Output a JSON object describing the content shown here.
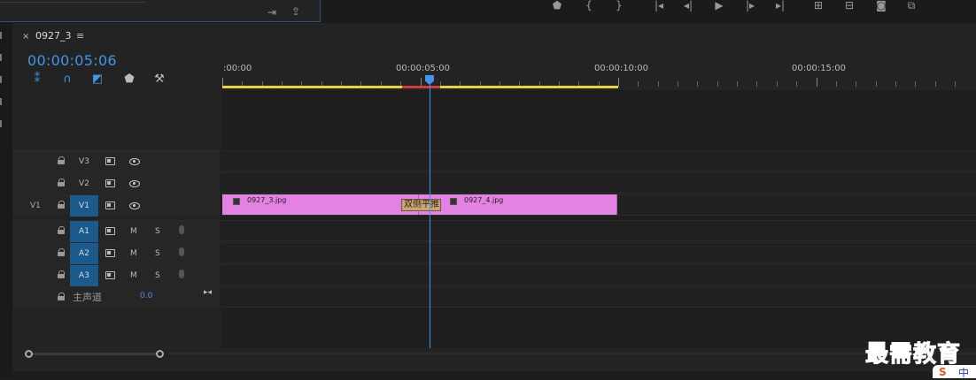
{
  "sequence": {
    "tab_close": "×",
    "tab_name": "0927_3",
    "tab_menu": "≡",
    "timecode": "00:00:05:06"
  },
  "ruler": {
    "labels": [
      ":00:00",
      "00:00:05:00",
      "00:00:10:00",
      "00:00:15:00"
    ]
  },
  "tracks": {
    "video": [
      {
        "target": "V3",
        "source": ""
      },
      {
        "target": "V2",
        "source": ""
      },
      {
        "target": "V1",
        "source": "V1"
      }
    ],
    "audio": [
      {
        "target": "A1",
        "m": "M",
        "s": "S"
      },
      {
        "target": "A2",
        "m": "M",
        "s": "S"
      },
      {
        "target": "A3",
        "m": "M",
        "s": "S"
      }
    ],
    "master": {
      "label": "主声道",
      "value": "0.0"
    }
  },
  "clips": [
    {
      "name": "0927_3.jpg"
    },
    {
      "name": "0927_4.jpg"
    }
  ],
  "transition": {
    "label": "双侧平推"
  },
  "watermark": {
    "text": "最需教育",
    "badge": "中"
  },
  "colors": {
    "accent": "#3f95e8",
    "clip": "#e382e3",
    "workbar": "#e7d62b",
    "render_red": "#d43a3a",
    "target_on": "#1a5a8c"
  }
}
